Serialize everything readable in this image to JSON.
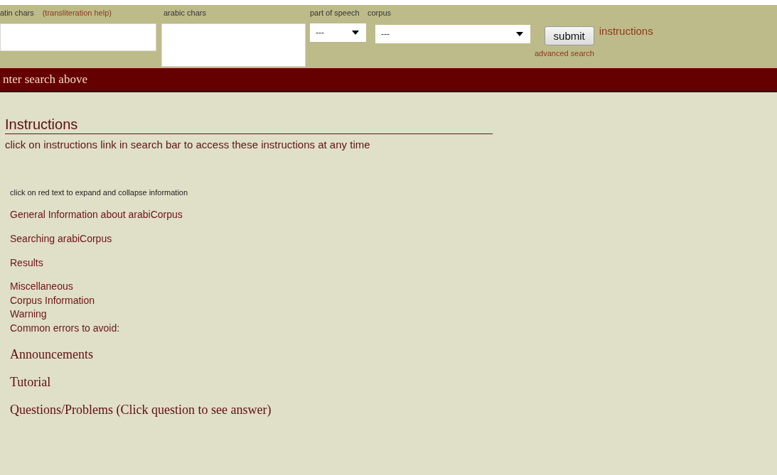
{
  "search_bar": {
    "latin_label": "atin chars",
    "help_link": "(transliteration help)",
    "arabic_label": "arabic chars",
    "pos_label": "part of speech",
    "pos_select": "---",
    "corpus_label": "corpus",
    "corpus_select": "---",
    "submit": "submit",
    "instructions_link": "instructions",
    "advanced_link": "advanced search"
  },
  "status_bar": {
    "text": "nter search above"
  },
  "instructions": {
    "title": "Instructions",
    "subtitle": "click on instructions link in search bar to access these instructions at any time",
    "hint": "click on red text to expand and collapse information",
    "sections": [
      {
        "kind": "topic",
        "label": "General Information about arabiCorpus"
      },
      {
        "kind": "topic",
        "label": "Searching arabiCorpus"
      },
      {
        "kind": "topic",
        "label": "Results"
      },
      {
        "kind": "group",
        "items": [
          "Miscellaneous",
          "Corpus Information",
          "Warning",
          "Common errors to avoid:"
        ]
      },
      {
        "kind": "heading",
        "label": "Announcements"
      },
      {
        "kind": "heading",
        "label": "Tutorial"
      },
      {
        "kind": "heading",
        "label": "Questions/Problems (Click question to see answer)"
      }
    ]
  }
}
